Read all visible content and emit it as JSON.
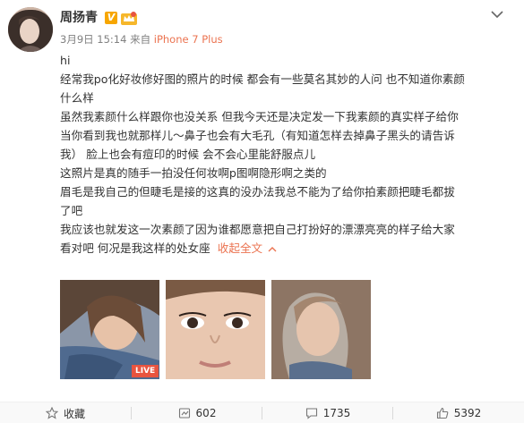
{
  "post": {
    "username": "周扬青",
    "verified_mark": "V",
    "meta_time": "3月9日 15:14 来自 ",
    "meta_device": "iPhone 7 Plus",
    "lines": [
      "hi",
      "经常我po化好妆修好图的照片的时候 都会有一些莫名其妙的人问 也不知道你素颜",
      "什么样",
      "虽然我素颜什么样跟你也没关系 但我今天还是决定发一下我素颜的真实样子给你",
      "当你看到我也就那样儿～鼻子也会有大毛孔（有知道怎样去掉鼻子黑头的请告诉",
      "我） 脸上也会有痘印的时候 会不会心里能舒服点儿",
      "这照片是真的随手一拍没任何妆啊p图啊隐形啊之类的",
      "眉毛是我自己的但睫毛是接的这真的没办法我总不能为了给你拍素颜把睫毛都拔",
      "了吧",
      "我应该也就发这一次素颜了因为谁都愿意把自己打扮好的漂漂亮亮的样子给大家",
      "看对吧 何况是我这样的处女座"
    ],
    "collapse_label": "收起全文",
    "live_label": "LIVE"
  },
  "actions": {
    "favorite_label": "收藏",
    "repost_count": "602",
    "comment_count": "1735",
    "like_count": "5392"
  },
  "colors": {
    "accent": "#eb7350",
    "verified": "#f7a600",
    "live": "#e8543f"
  },
  "icons": [
    "chevron-down-icon",
    "star-icon",
    "repost-icon",
    "comment-icon",
    "like-icon",
    "caret-up-icon",
    "crown-icon"
  ]
}
